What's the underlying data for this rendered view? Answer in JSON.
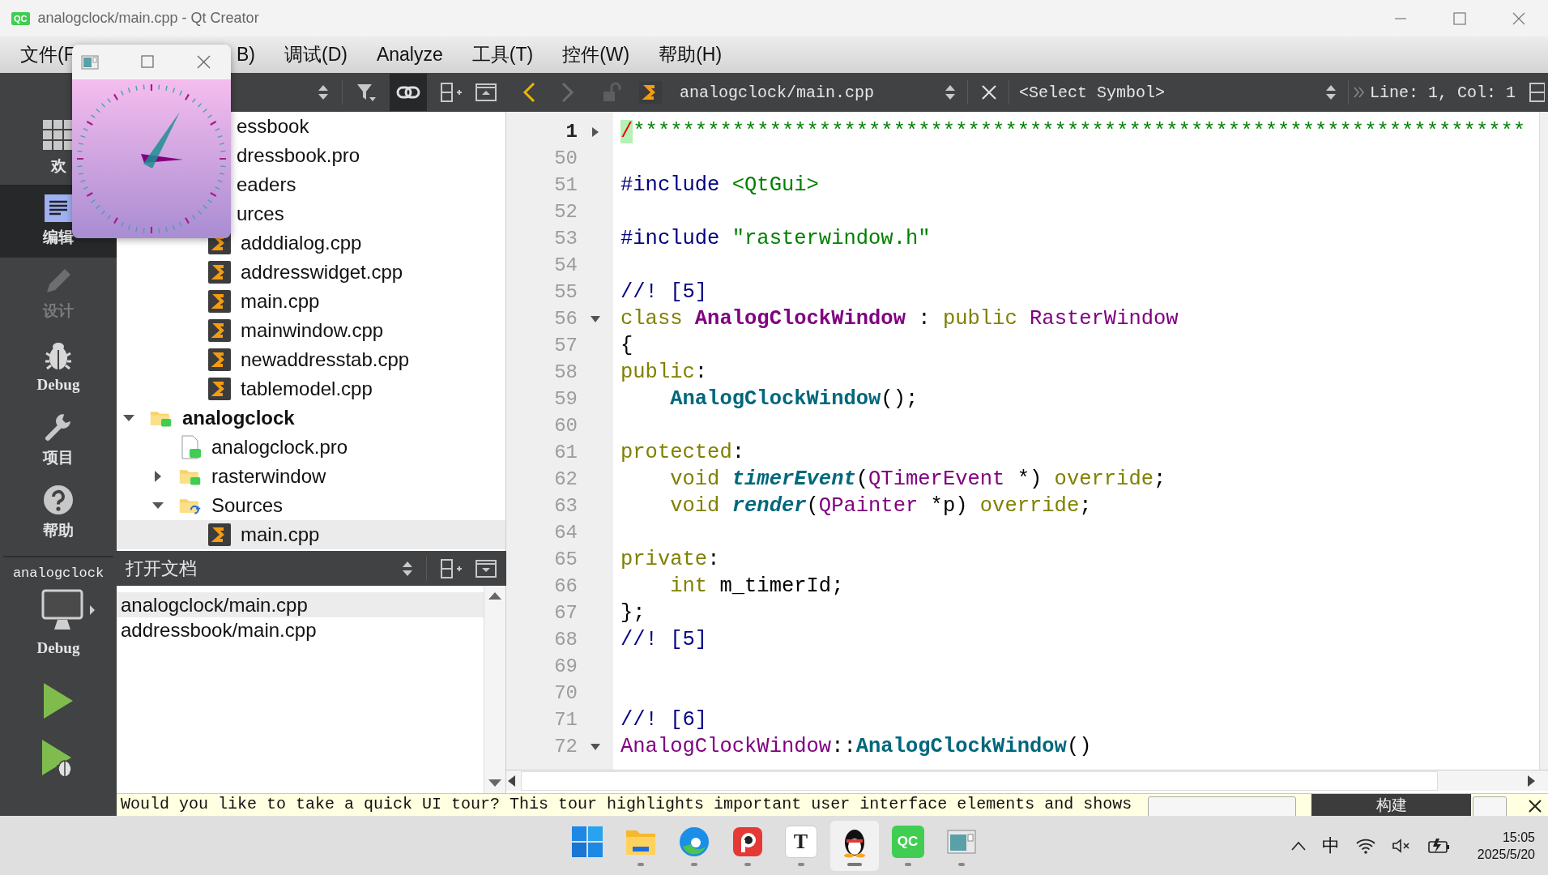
{
  "window": {
    "icon_label": "QC",
    "title": "analogclock/main.cpp - Qt Creator"
  },
  "menu": [
    {
      "label": "文件(F"
    },
    {
      "label": "B)"
    },
    {
      "label": "调试(D)"
    },
    {
      "label": "Analyze"
    },
    {
      "label": "工具(T)"
    },
    {
      "label": "控件(W)"
    },
    {
      "label": "帮助(H)"
    }
  ],
  "mode_bar": {
    "modes": [
      {
        "label": "欢",
        "kind": "welcome",
        "selected": false,
        "disabled": false
      },
      {
        "label": "编辑",
        "kind": "edit",
        "selected": true,
        "disabled": false
      },
      {
        "label": "设计",
        "kind": "design",
        "selected": false,
        "disabled": true
      },
      {
        "label": "Debug",
        "kind": "debug",
        "selected": false,
        "disabled": false
      },
      {
        "label": "项目",
        "kind": "project",
        "selected": false,
        "disabled": false
      },
      {
        "label": "帮助",
        "kind": "help",
        "selected": false,
        "disabled": false
      }
    ],
    "kit": {
      "project": "analogclock",
      "build": "Debug"
    }
  },
  "project_tree": {
    "sync_with_editor": true,
    "nodes": [
      {
        "label": "essbook",
        "selected": false,
        "children": [
          {
            "label": "dressbook.pro",
            "selected": false
          },
          {
            "label": "eaders",
            "selected": false
          },
          {
            "label": "urces",
            "selected": false,
            "children": [
              {
                "label": "adddialog.cpp",
                "kind": "cpp-file",
                "selected": false
              },
              {
                "label": "addresswidget.cpp",
                "kind": "cpp-file",
                "selected": false
              },
              {
                "label": "main.cpp",
                "kind": "cpp-file",
                "selected": false
              },
              {
                "label": "mainwindow.cpp",
                "kind": "cpp-file",
                "selected": false
              },
              {
                "label": "newaddresstab.cpp",
                "kind": "cpp-file",
                "selected": false
              },
              {
                "label": "tablemodel.cpp",
                "kind": "cpp-file",
                "selected": false
              }
            ]
          }
        ]
      },
      {
        "label": "analogclock",
        "kind": "project",
        "active": true,
        "expanded": true,
        "selected": false,
        "children": [
          {
            "label": "analogclock.pro",
            "kind": "pro-file",
            "selected": false
          },
          {
            "label": "rasterwindow",
            "kind": "qt-folder",
            "expanded": false,
            "selected": false
          },
          {
            "label": "Sources",
            "kind": "source-folder",
            "expanded": true,
            "selected": false,
            "children": [
              {
                "label": "main.cpp",
                "kind": "cpp-file",
                "selected": true
              }
            ]
          }
        ]
      }
    ]
  },
  "open_documents": {
    "title": "打开文档",
    "items": [
      {
        "label": "analogclock/main.cpp",
        "selected": true
      },
      {
        "label": "addressbook/main.cpp",
        "selected": false
      }
    ]
  },
  "editor": {
    "file": "analogclock/main.cpp",
    "symbol": "<Select Symbol>",
    "position": "Line: 1, Col: 1",
    "lines": [
      {
        "number": "1",
        "current": true,
        "expanded": false,
        "tokens": [
          {
            "kind": "cursor",
            "text": "/"
          },
          {
            "kind": "stars",
            "text": "************************************************************************"
          }
        ]
      },
      {
        "number": "50",
        "current": false
      },
      {
        "number": "51",
        "current": false,
        "tokens": [
          {
            "kind": "pp",
            "text": "#include"
          },
          {
            "kind": "str",
            "text": " <QtGui>"
          }
        ]
      },
      {
        "number": "52",
        "current": false
      },
      {
        "number": "53",
        "current": false,
        "tokens": [
          {
            "kind": "pp",
            "text": "#include"
          },
          {
            "kind": "str",
            "text": " \"rasterwindow.h\""
          }
        ]
      },
      {
        "number": "54",
        "current": false
      },
      {
        "number": "55",
        "current": false,
        "tokens": [
          {
            "kind": "cmt",
            "text": "//! [5]"
          }
        ]
      },
      {
        "number": "56",
        "current": false,
        "expanded": true,
        "tokens": [
          {
            "kind": "kw",
            "text": "class"
          },
          {
            "kind": "typeb",
            "text": " AnalogClockWindow"
          },
          {
            "kind": "txt",
            "text": " : "
          },
          {
            "kind": "kw",
            "text": "public"
          },
          {
            "kind": "type",
            "text": " RasterWindow"
          }
        ]
      },
      {
        "number": "57",
        "current": false,
        "tokens": [
          {
            "kind": "txt",
            "text": "{"
          }
        ]
      },
      {
        "number": "58",
        "current": false,
        "tokens": [
          {
            "kind": "kw",
            "text": "public"
          },
          {
            "kind": "txt",
            "text": ":"
          }
        ]
      },
      {
        "number": "59",
        "current": false,
        "tokens": [
          {
            "kind": "fn",
            "text": "    AnalogClockWindow"
          },
          {
            "kind": "txt",
            "text": "();"
          }
        ]
      },
      {
        "number": "60",
        "current": false
      },
      {
        "number": "61",
        "current": false,
        "tokens": [
          {
            "kind": "kw",
            "text": "protected"
          },
          {
            "kind": "txt",
            "text": ":"
          }
        ]
      },
      {
        "number": "62",
        "current": false,
        "tokens": [
          {
            "kind": "kw",
            "text": "    void"
          },
          {
            "kind": "fni",
            "text": " timerEvent"
          },
          {
            "kind": "txt",
            "text": "("
          },
          {
            "kind": "type",
            "text": "QTimerEvent"
          },
          {
            "kind": "txt",
            "text": " *) "
          },
          {
            "kind": "kw",
            "text": "override"
          },
          {
            "kind": "txt",
            "text": ";"
          }
        ]
      },
      {
        "number": "63",
        "current": false,
        "tokens": [
          {
            "kind": "kw",
            "text": "    void"
          },
          {
            "kind": "fni",
            "text": " render"
          },
          {
            "kind": "txt",
            "text": "("
          },
          {
            "kind": "type",
            "text": "QPainter"
          },
          {
            "kind": "txt",
            "text": " *p) "
          },
          {
            "kind": "kw",
            "text": "override"
          },
          {
            "kind": "txt",
            "text": ";"
          }
        ]
      },
      {
        "number": "64",
        "current": false
      },
      {
        "number": "65",
        "current": false,
        "tokens": [
          {
            "kind": "kw",
            "text": "private"
          },
          {
            "kind": "txt",
            "text": ":"
          }
        ]
      },
      {
        "number": "66",
        "current": false,
        "tokens": [
          {
            "kind": "kw",
            "text": "    int"
          },
          {
            "kind": "txt",
            "text": " m_timerId;"
          }
        ]
      },
      {
        "number": "67",
        "current": false,
        "tokens": [
          {
            "kind": "txt",
            "text": "};"
          }
        ]
      },
      {
        "number": "68",
        "current": false,
        "tokens": [
          {
            "kind": "cmt",
            "text": "//! [5]"
          }
        ]
      },
      {
        "number": "69",
        "current": false
      },
      {
        "number": "70",
        "current": false
      },
      {
        "number": "71",
        "current": false,
        "tokens": [
          {
            "kind": "cmt",
            "text": "//! [6]"
          }
        ]
      },
      {
        "number": "72",
        "current": false,
        "expanded": true,
        "tokens": [
          {
            "kind": "type",
            "text": "AnalogClockWindow"
          },
          {
            "kind": "txt",
            "text": "::"
          },
          {
            "kind": "fn",
            "text": "AnalogClockWindow"
          },
          {
            "kind": "txt",
            "text": "()"
          }
        ]
      }
    ]
  },
  "tour": {
    "message": "Would you like to take a quick UI tour? This tour highlights important user interface elements and shows",
    "tooltip": "构建"
  },
  "taskbar": {
    "apps": [
      {
        "kind": "start",
        "open": false,
        "active": false
      },
      {
        "kind": "files",
        "open": true,
        "active": false
      },
      {
        "kind": "browser",
        "open": true,
        "active": false
      },
      {
        "kind": "red-app",
        "open": true,
        "active": false
      },
      {
        "kind": "text-app",
        "label": "T",
        "open": true,
        "active": false
      },
      {
        "kind": "penguin",
        "open": true,
        "active": true
      },
      {
        "kind": "qt-creator",
        "label": "QC",
        "open": true,
        "active": false
      },
      {
        "kind": "window-app",
        "open": true,
        "active": false
      }
    ],
    "input_method": "中",
    "time": "15:05",
    "date": "2025/5/20"
  }
}
